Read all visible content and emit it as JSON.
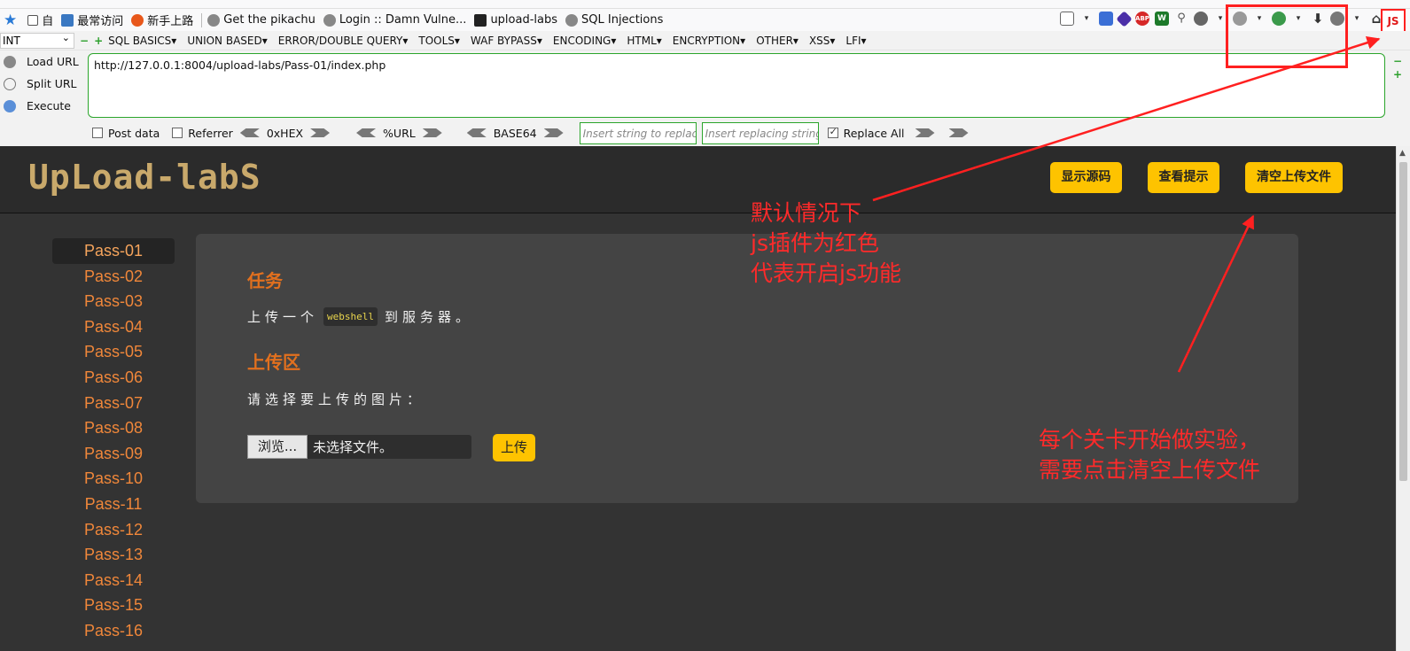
{
  "bookmarks": {
    "items": [
      {
        "label": "自"
      },
      {
        "label": "最常访问"
      },
      {
        "label": "新手上路"
      },
      {
        "label": "Get the pikachu"
      },
      {
        "label": "Login :: Damn Vulne..."
      },
      {
        "label": "upload-labs"
      },
      {
        "label": "SQL Injections"
      }
    ]
  },
  "toolbar": {
    "js_label": "JS"
  },
  "hackbar": {
    "select_value": "INT",
    "menus": [
      "SQL BASICS▾",
      "UNION BASED▾",
      "ERROR/DOUBLE QUERY▾",
      "TOOLS▾",
      "WAF BYPASS▾",
      "ENCODING▾",
      "HTML▾",
      "ENCRYPTION▾",
      "OTHER▾",
      "XSS▾",
      "LFI▾"
    ],
    "load_url": "Load URL",
    "split_url": "Split URL",
    "execute": "Execute",
    "url": "http://127.0.0.1:8004/upload-labs/Pass-01/index.php",
    "post_data": "Post data",
    "referrer": "Referrer",
    "hex": "0xHEX",
    "urlenc": "%URL",
    "base64": "BASE64",
    "insert_placeholder": "Insert string to replace",
    "replacing_placeholder": "Insert replacing string",
    "replace_all": "Replace All"
  },
  "site": {
    "logo": "UpLoad-labS",
    "btn_source": "显示源码",
    "btn_hint": "查看提示",
    "btn_clear": "清空上传文件"
  },
  "sidebar": {
    "passes": [
      "Pass-01",
      "Pass-02",
      "Pass-03",
      "Pass-04",
      "Pass-05",
      "Pass-06",
      "Pass-07",
      "Pass-08",
      "Pass-09",
      "Pass-10",
      "Pass-11",
      "Pass-12",
      "Pass-13",
      "Pass-14",
      "Pass-15",
      "Pass-16"
    ],
    "active": "Pass-01"
  },
  "task": {
    "title": "任务",
    "text_before": "上传一个",
    "code": "webshell",
    "text_after": "到服务器。",
    "upload_title": "上传区",
    "choose_label": "请选择要上传的图片：",
    "browse": "浏览...",
    "file_status": "未选择文件。",
    "upload_button": "上传"
  },
  "annotations": {
    "note1": [
      "默认情况下",
      "js插件为红色",
      "代表开启js功能"
    ],
    "note2": [
      "每个关卡开始做实验，",
      "需要点击清空上传文件"
    ]
  },
  "colors": {
    "accent": "#fec300",
    "pass_link": "#f0873a",
    "annotation": "#ff2a2a"
  }
}
